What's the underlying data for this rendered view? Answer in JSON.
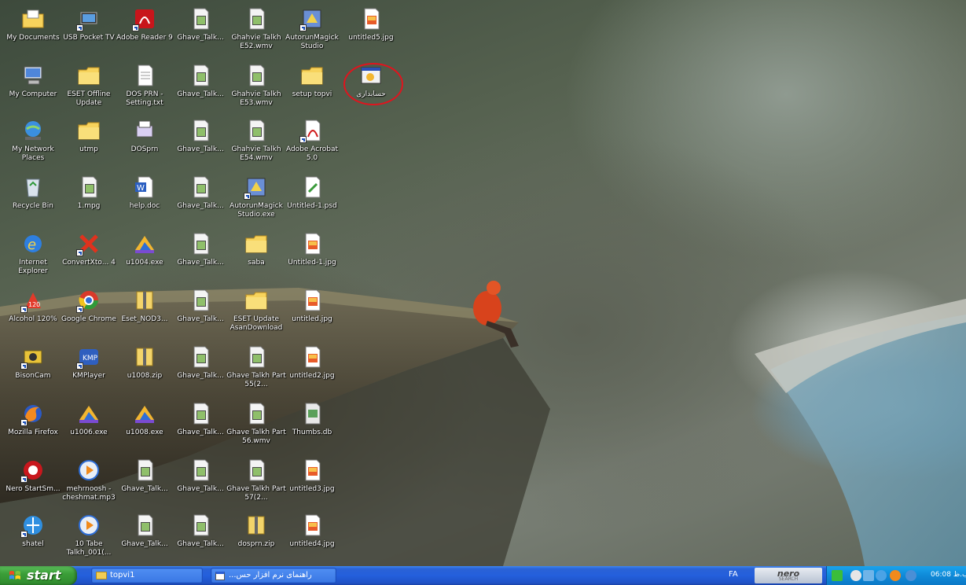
{
  "desktop": {
    "icons": [
      {
        "label": "My Documents",
        "icon": "my-documents-icon",
        "col": 0,
        "row": 0
      },
      {
        "label": "My Computer",
        "icon": "my-computer-icon",
        "col": 0,
        "row": 1
      },
      {
        "label": "My Network Places",
        "icon": "network-places-icon",
        "col": 0,
        "row": 2
      },
      {
        "label": "Recycle Bin",
        "icon": "recycle-bin-icon",
        "col": 0,
        "row": 3
      },
      {
        "label": "Internet Explorer",
        "icon": "internet-explorer-icon",
        "col": 0,
        "row": 4
      },
      {
        "label": "Alcohol 120%",
        "icon": "alcohol-120-icon",
        "col": 0,
        "row": 5
      },
      {
        "label": "BisonCam",
        "icon": "bisoncam-icon",
        "col": 0,
        "row": 6
      },
      {
        "label": "Mozilla Firefox",
        "icon": "firefox-icon",
        "col": 0,
        "row": 7
      },
      {
        "label": "Nero StartSm...",
        "icon": "nero-icon",
        "col": 0,
        "row": 8
      },
      {
        "label": "shatel",
        "icon": "shatel-icon",
        "col": 0,
        "row": 9
      },
      {
        "label": "USB Pocket TV",
        "icon": "usb-pocket-tv-icon",
        "col": 1,
        "row": 0
      },
      {
        "label": "ESET Offline Update",
        "icon": "folder-icon",
        "col": 1,
        "row": 1
      },
      {
        "label": "utmp",
        "icon": "folder-icon",
        "col": 1,
        "row": 2
      },
      {
        "label": "1.mpg",
        "icon": "video-file-icon",
        "col": 1,
        "row": 3
      },
      {
        "label": "ConvertXto... 4",
        "icon": "convertx-icon",
        "col": 1,
        "row": 4
      },
      {
        "label": "Google Chrome",
        "icon": "chrome-icon",
        "col": 1,
        "row": 5
      },
      {
        "label": "KMPlayer",
        "icon": "kmplayer-icon",
        "col": 1,
        "row": 6
      },
      {
        "label": "u1006.exe",
        "icon": "installer-icon",
        "col": 1,
        "row": 7
      },
      {
        "label": "mehrnoosh - cheshmat.mp3",
        "icon": "media-player-icon",
        "col": 1,
        "row": 8
      },
      {
        "label": "10 Tabe Talkh_001(...",
        "icon": "media-player-icon",
        "col": 1,
        "row": 9
      },
      {
        "label": "Adobe Reader 9",
        "icon": "adobe-reader-icon",
        "col": 2,
        "row": 0
      },
      {
        "label": "DOS PRN - Setting.txt",
        "icon": "text-file-icon",
        "col": 2,
        "row": 1
      },
      {
        "label": "DOSprn",
        "icon": "dosprn-icon",
        "col": 2,
        "row": 2
      },
      {
        "label": "help.doc",
        "icon": "word-doc-icon",
        "col": 2,
        "row": 3
      },
      {
        "label": "u1004.exe",
        "icon": "installer-icon",
        "col": 2,
        "row": 4
      },
      {
        "label": "Eset_NOD3...",
        "icon": "zip-file-icon",
        "col": 2,
        "row": 5
      },
      {
        "label": "u1008.zip",
        "icon": "zip-file-icon",
        "col": 2,
        "row": 6
      },
      {
        "label": "u1008.exe",
        "icon": "installer-icon",
        "col": 2,
        "row": 7
      },
      {
        "label": "Ghave_Talk...",
        "icon": "video-file-icon",
        "col": 2,
        "row": 8
      },
      {
        "label": "Ghave_Talk...",
        "icon": "video-file-icon",
        "col": 2,
        "row": 9
      },
      {
        "label": "Ghave_Talk...",
        "icon": "video-file-icon",
        "col": 3,
        "row": 0
      },
      {
        "label": "Ghave_Talk...",
        "icon": "video-file-icon",
        "col": 3,
        "row": 1
      },
      {
        "label": "Ghave_Talk...",
        "icon": "video-file-icon",
        "col": 3,
        "row": 2
      },
      {
        "label": "Ghave_Talk...",
        "icon": "video-file-icon",
        "col": 3,
        "row": 3
      },
      {
        "label": "Ghave_Talk...",
        "icon": "video-file-icon",
        "col": 3,
        "row": 4
      },
      {
        "label": "Ghave_Talk...",
        "icon": "video-file-icon",
        "col": 3,
        "row": 5
      },
      {
        "label": "Ghave_Talk...",
        "icon": "video-file-icon",
        "col": 3,
        "row": 6
      },
      {
        "label": "Ghave_Talk...",
        "icon": "video-file-icon",
        "col": 3,
        "row": 7
      },
      {
        "label": "Ghave_Talk...",
        "icon": "video-file-icon",
        "col": 3,
        "row": 8
      },
      {
        "label": "Ghave_Talk...",
        "icon": "video-file-icon",
        "col": 3,
        "row": 9
      },
      {
        "label": "Ghahvie Talkh E52.wmv",
        "icon": "video-file-icon",
        "col": 4,
        "row": 0
      },
      {
        "label": "Ghahvie Talkh E53.wmv",
        "icon": "video-file-icon",
        "col": 4,
        "row": 1
      },
      {
        "label": "Ghahvie Talkh E54.wmv",
        "icon": "video-file-icon",
        "col": 4,
        "row": 2
      },
      {
        "label": "AutorunMagick Studio.exe",
        "icon": "autorunmagick-icon",
        "col": 4,
        "row": 3
      },
      {
        "label": "saba",
        "icon": "folder-icon",
        "col": 4,
        "row": 4
      },
      {
        "label": "ESET Update AsanDownload",
        "icon": "folder-icon",
        "col": 4,
        "row": 5
      },
      {
        "label": "Ghave Talkh Part 55(2...",
        "icon": "video-file-icon",
        "col": 4,
        "row": 6
      },
      {
        "label": "Ghave Talkh Part 56.wmv",
        "icon": "video-file-icon",
        "col": 4,
        "row": 7
      },
      {
        "label": "Ghave Talkh Part 57(2...",
        "icon": "video-file-icon",
        "col": 4,
        "row": 8
      },
      {
        "label": "dosprn.zip",
        "icon": "zip-file-icon",
        "col": 4,
        "row": 9
      },
      {
        "label": "AutorunMagick Studio",
        "icon": "autorunmagick-icon",
        "col": 5,
        "row": 0
      },
      {
        "label": "setup topvi",
        "icon": "folder-icon",
        "col": 5,
        "row": 1
      },
      {
        "label": "Adobe Acrobat 5.0",
        "icon": "adobe-acrobat-icon",
        "col": 5,
        "row": 2
      },
      {
        "label": "Untitled-1.psd",
        "icon": "psd-file-icon",
        "col": 5,
        "row": 3
      },
      {
        "label": "Untitled-1.jpg",
        "icon": "image-file-icon",
        "col": 5,
        "row": 4
      },
      {
        "label": "untitled.jpg",
        "icon": "image-file-icon",
        "col": 5,
        "row": 5
      },
      {
        "label": "untitled2.jpg",
        "icon": "image-file-icon",
        "col": 5,
        "row": 6
      },
      {
        "label": "Thumbs.db",
        "icon": "thumbs-db-icon",
        "col": 5,
        "row": 7
      },
      {
        "label": "untitled3.jpg",
        "icon": "image-file-icon",
        "col": 5,
        "row": 8
      },
      {
        "label": "untitled4.jpg",
        "icon": "image-file-icon",
        "col": 5,
        "row": 9
      },
      {
        "label": "untitled5.jpg",
        "icon": "image-file-icon",
        "col": 6,
        "row": 0
      },
      {
        "label": "حسابداری",
        "icon": "accounting-app-icon",
        "col": 6,
        "row": 1,
        "highlighted": true
      }
    ]
  },
  "taskbar": {
    "start_label": "start",
    "tasks": [
      {
        "label": "topvi1",
        "icon": "folder-icon"
      },
      {
        "label": "راهنمای نرم افزار حس...",
        "icon": "window-icon"
      }
    ],
    "language": "FA",
    "nero_logo": "nero",
    "nero_sub": "SEARCH",
    "clock": "06:08 ب.ظ"
  },
  "colors": {
    "taskbar_blue": "#245fdc",
    "start_green": "#3b9e38",
    "tray_blue": "#0f8ad8",
    "highlight_red": "#e0141e"
  }
}
